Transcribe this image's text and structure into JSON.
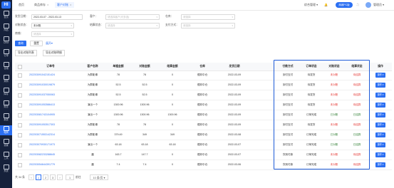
{
  "sidebar": {
    "logo": "HI",
    "items": [
      {
        "label": "首页",
        "top": 0
      },
      {
        "label": "商品",
        "top": 0
      },
      {
        "label": "CRM",
        "top": 0
      },
      {
        "label": "订单",
        "top": 0
      },
      {
        "label": "仓储",
        "top": 0
      },
      {
        "label": "采购",
        "top": 0
      },
      {
        "label": "库存",
        "top": 0
      },
      {
        "label": "财务",
        "top": 0
      },
      {
        "label": "报表",
        "top": 0
      },
      {
        "label": "电商",
        "top": 0
      },
      {
        "label": "设置",
        "top": 0
      },
      {
        "label": "工具",
        "top": 0
      },
      {
        "label": "系统",
        "top": 0
      }
    ]
  },
  "header": {
    "tabs": [
      "首页",
      "商品库存",
      "客户对账"
    ],
    "org": "综合管理",
    "mall": "商城PC版",
    "user": "管理员"
  },
  "filters": {
    "date_label": "发货日期：",
    "date_value": "2022-03-07 - 2022-03-13",
    "customer_label": "客户：",
    "customer_placeholder": "请选择客户(可多选)",
    "warehouse_label": "仓库：",
    "warehouse_placeholder": "请选择",
    "recon_label": "对账状态：",
    "recon_value": "未对账",
    "settle_label": "结算状态：",
    "settle_placeholder": "请选择",
    "pay_label": "支付方式：",
    "pay_placeholder": "请选择",
    "more_label": "商铺：",
    "more_placeholder": "请选择",
    "search": "查询",
    "reset": "重置",
    "expand": "展开",
    "export_recon": "导出对账列表",
    "export_detail": "导出对账明细"
  },
  "table": {
    "headers": [
      "订单号",
      "客户名称",
      "单据金额",
      "对账金额",
      "结算金额",
      "仓库",
      "发货日期",
      "付款方式",
      "订单状态",
      "对账状态",
      "结算状态",
      "操作"
    ],
    "rows": [
      {
        "order": "202203091042151424",
        "customer": "为群影像",
        "doc": "78",
        "recon": "78",
        "settle": "0",
        "wh": "德邦中仓",
        "date": "2022-03-09",
        "pay": "到付支付",
        "status": "待发货",
        "recon_status": "未对账",
        "settle_status": "待结算",
        "rs_color": "red",
        "ss_color": "red"
      },
      {
        "order": "202203091030019879",
        "customer": "为群影像",
        "doc": "52.5",
        "recon": "52.5",
        "settle": "0",
        "wh": "德邦中仓",
        "date": "2022-03-09",
        "pay": "到付支付",
        "status": "待发货",
        "recon_status": "未对账",
        "settle_status": "待结算",
        "rs_color": "red",
        "ss_color": "red"
      },
      {
        "order": "202203091037050063",
        "customer": "为群影像",
        "doc": "52.5",
        "recon": "52.5",
        "settle": "0",
        "wh": "德邦中仓",
        "date": "2022-03-09",
        "pay": "到付支付",
        "status": "待发货",
        "recon_status": "未对账",
        "settle_status": "待结算",
        "rs_color": "red",
        "ss_color": "red"
      },
      {
        "order": "202203091053586413",
        "customer": "演出一个",
        "doc": "1300.96",
        "recon": "1300.96",
        "settle": "0",
        "wh": "德邦中仓",
        "date": "2022-03-09",
        "pay": "到付支付",
        "status": "待发货",
        "recon_status": "未对账",
        "settle_status": "待结算",
        "rs_color": "red",
        "ss_color": "red"
      },
      {
        "order": "202203081743104905",
        "customer": "演出一个",
        "doc": "1300.96",
        "recon": "1300.96",
        "settle": "1300.96",
        "wh": "德邦中仓",
        "date": "2022-03-09",
        "pay": "到付支付",
        "status": "订单完成",
        "recon_status": "已对账",
        "settle_status": "已结算",
        "rs_color": "green",
        "ss_color": "green"
      },
      {
        "order": "202203091053517303",
        "customer": "为群影像",
        "doc": "78",
        "recon": "78",
        "settle": "0",
        "wh": "德邦中仓",
        "date": "2022-03-09",
        "pay": "到付支付",
        "status": "待发货",
        "recon_status": "未对账",
        "settle_status": "待结算",
        "rs_color": "red",
        "ss_color": "red"
      },
      {
        "order": "202203071553142314",
        "customer": "为群影像",
        "doc": "379.49",
        "recon": "349",
        "settle": "349",
        "wh": "德邦中仓",
        "date": "2022-03-08",
        "pay": "到付支付",
        "status": "订单完成",
        "recon_status": "已对账",
        "settle_status": "已结算",
        "rs_color": "green",
        "ss_color": "green"
      },
      {
        "order": "202203070930171973",
        "customer": "演出一个",
        "doc": "63.18",
        "recon": "63.18",
        "settle": "63.18",
        "wh": "德邦中仓",
        "date": "2022-03-07",
        "pay": "到付支付",
        "status": "订单完成",
        "recon_status": "已对账",
        "settle_status": "已结算",
        "rs_color": "green",
        "ss_color": "green"
      },
      {
        "order": "202203082233288645",
        "customer": "晨",
        "doc": "163.7",
        "recon": "147.7",
        "settle": "0",
        "wh": "德邦中仓",
        "date": "2022-03-07",
        "pay": "货到付款",
        "status": "订单完成",
        "recon_status": "未对账",
        "settle_status": "待结算",
        "rs_color": "red",
        "ss_color": "red"
      },
      {
        "order": "202203054644391779",
        "customer": "晨",
        "doc": "7.4",
        "recon": "7.4",
        "settle": "0",
        "wh": "德邦中仓",
        "date": "2022-03-06",
        "pay": "货到付款",
        "status": "订单完成",
        "recon_status": "未对账",
        "settle_status": "待结算",
        "rs_color": "red",
        "ss_color": "red"
      }
    ],
    "op_label": "操作"
  },
  "pager": {
    "total": "共 34 条",
    "pages": [
      "1",
      "2",
      "3"
    ],
    "goto": "前往",
    "page_size": "10 条/页"
  },
  "colors": {
    "accent": "#2b6ff2",
    "sidebar": "#16213b",
    "highlight": "#1e5bd8",
    "red": "#e53935",
    "green": "#2e7d32"
  }
}
